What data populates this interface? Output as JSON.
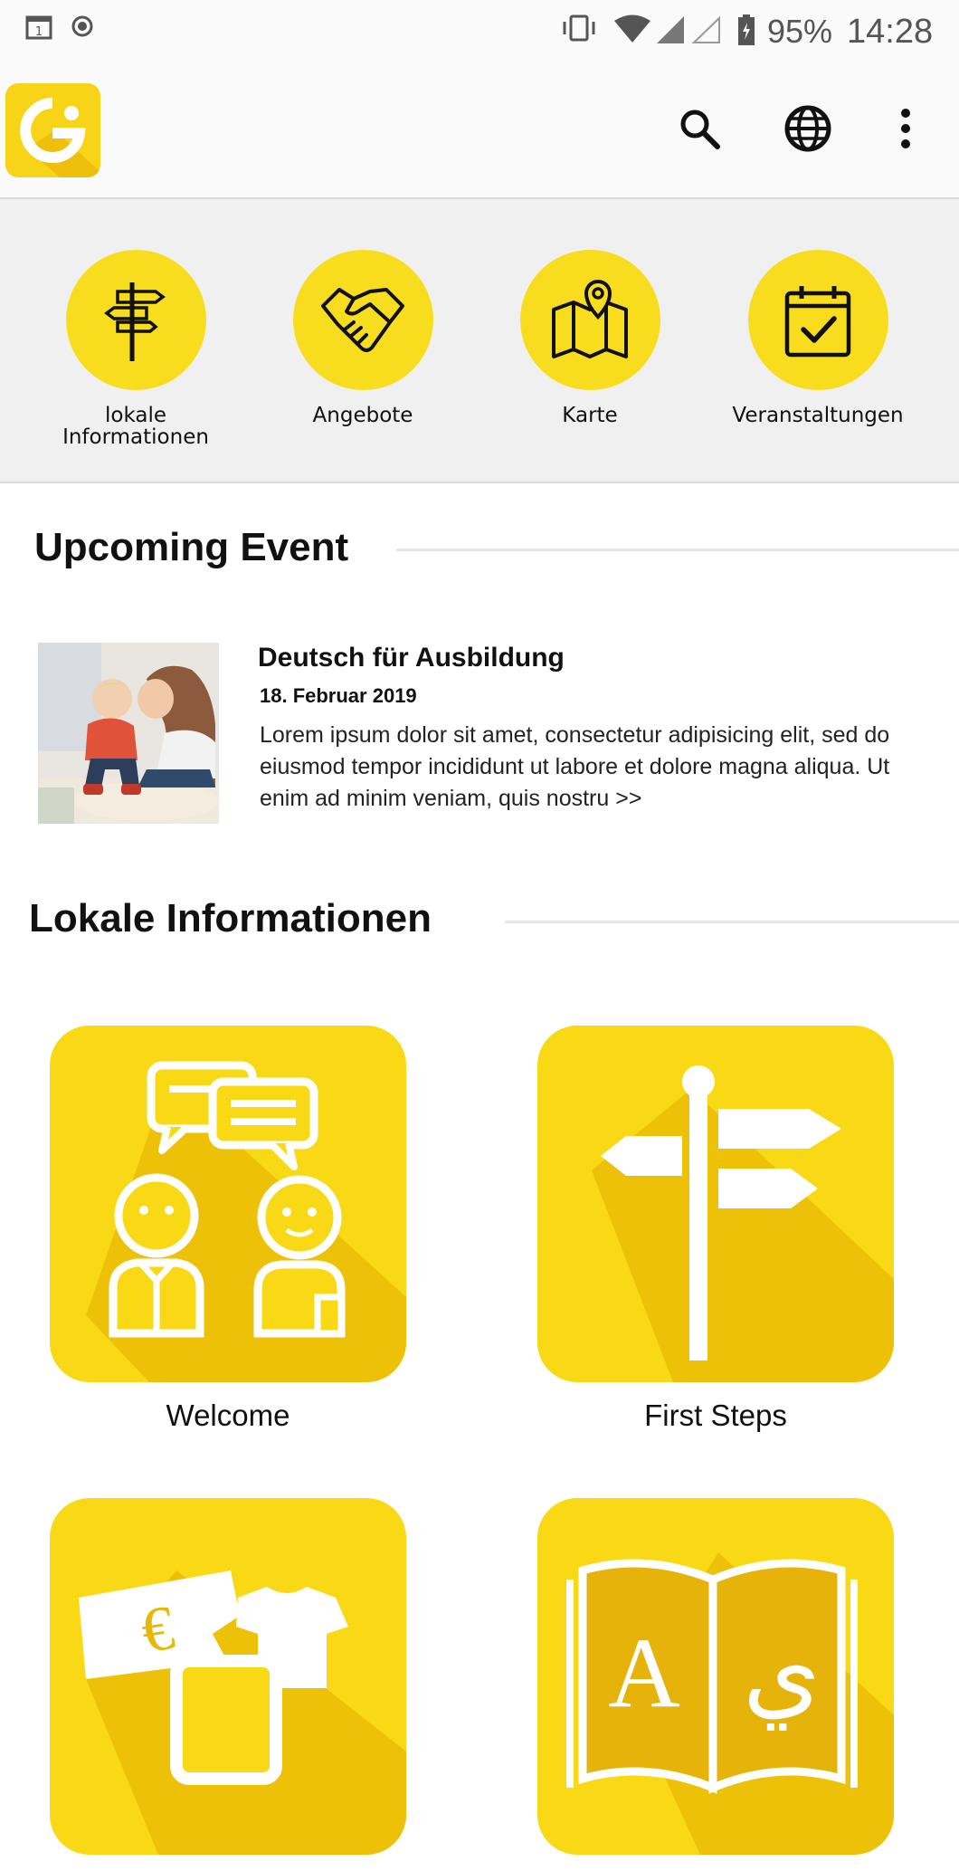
{
  "status_bar": {
    "battery": "95%",
    "time": "14:28"
  },
  "appbar": {
    "logo_icon": "g-logo-icon",
    "actions": [
      "search-icon",
      "globe-icon",
      "more-vert-icon"
    ]
  },
  "categories": [
    {
      "label": "lokale\nInformationen",
      "icon": "signpost-icon"
    },
    {
      "label": "Angebote",
      "icon": "handshake-icon"
    },
    {
      "label": "Karte",
      "icon": "map-pin-icon"
    },
    {
      "label": "Veranstaltungen",
      "icon": "calendar-check-icon"
    }
  ],
  "upcoming": {
    "heading": "Upcoming Event",
    "event": {
      "title": "Deutsch für Ausbildung",
      "date": "18. Februar 2019",
      "description": "Lorem ipsum dolor sit amet, consectetur adipisicing elit, sed do eiusmod tempor incididunt ut labore et dolore magna aliqua. Ut enim ad minim veniam, quis nostru >>"
    }
  },
  "local_info": {
    "heading": "Lokale Informationen",
    "tiles": [
      {
        "label": "Welcome",
        "icon": "people-chat-icon"
      },
      {
        "label": "First Steps",
        "icon": "signpost-icon"
      },
      {
        "label": "",
        "icon": "shopping-icon"
      },
      {
        "label": "",
        "icon": "language-book-icon"
      }
    ]
  },
  "colors": {
    "accent_yellow": "#f8dd1f",
    "tile_yellow": "#f9d916",
    "tile_shadow": "#e9b806"
  }
}
